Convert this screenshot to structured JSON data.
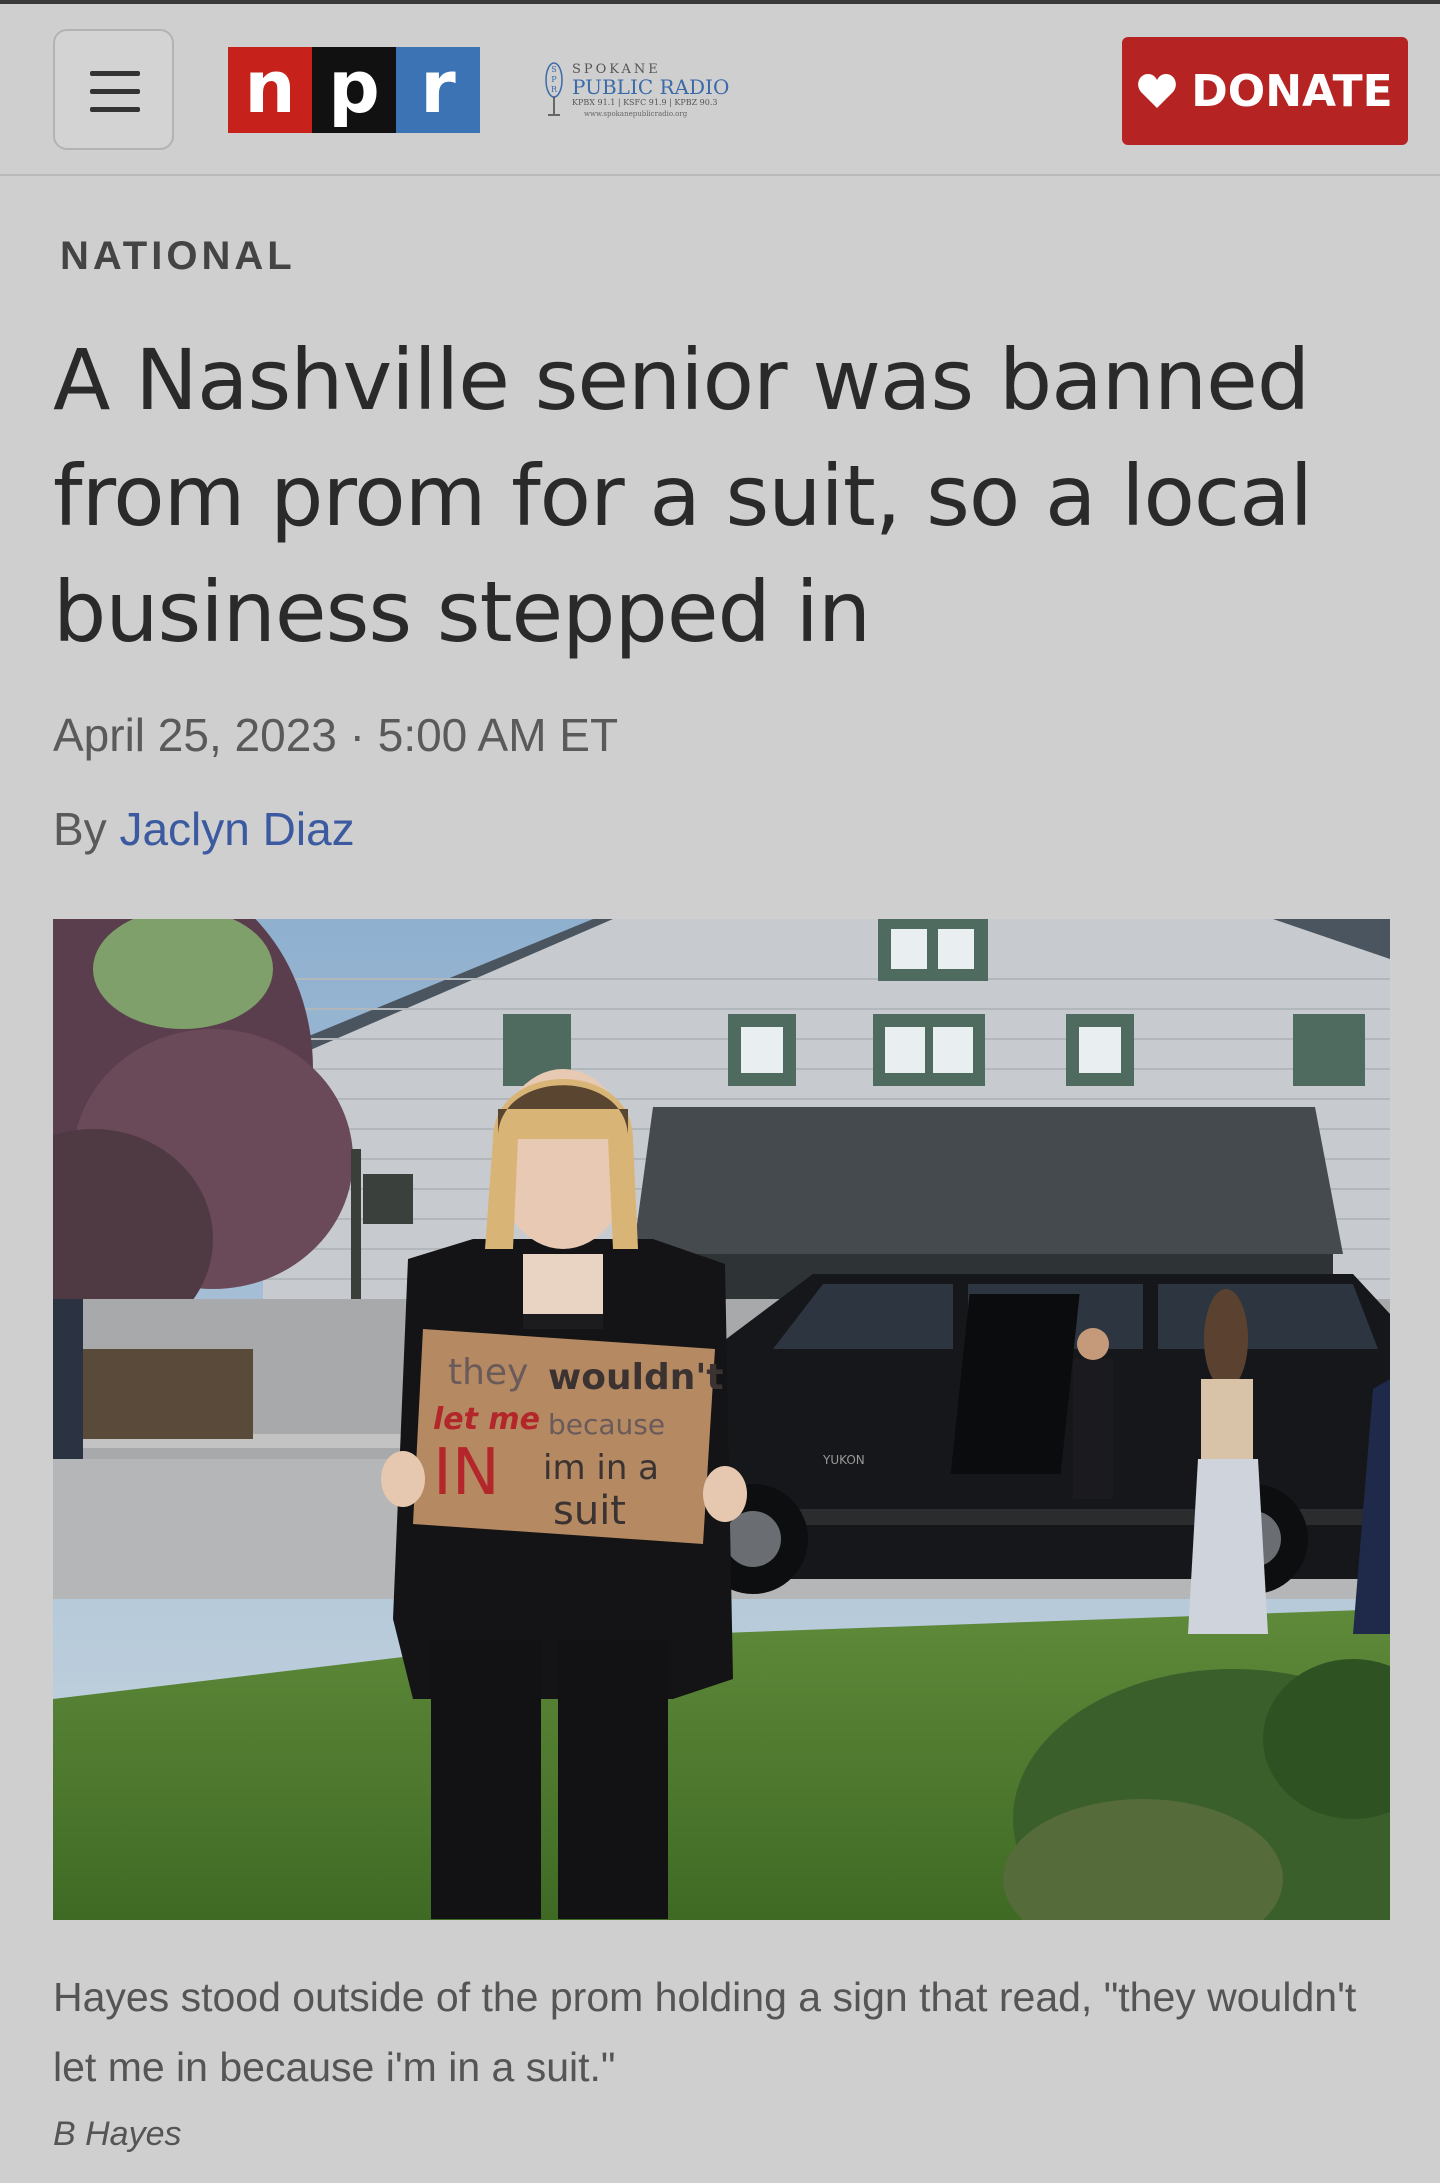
{
  "header": {
    "npr_logo": [
      "n",
      "p",
      "r"
    ],
    "station": {
      "top": "SPOKANE",
      "name": "PUBLIC RADIO",
      "frequencies": "KPBX 91.1 | KSFC 91.9 | KPBZ 90.3",
      "url": "www.spokanepublicradio.org"
    },
    "donate_label": "DONATE",
    "colors": {
      "npr_n": "#c7211b",
      "npr_p": "#111111",
      "npr_r": "#3b73b4",
      "donate": "#b52323"
    }
  },
  "article": {
    "section": "NATIONAL",
    "headline": "A Nashville senior was banned from prom for a suit, so a local business stepped in",
    "date": "April 25, 2023 · 5:00 AM ET",
    "by_prefix": "By",
    "author": "Jaclyn Diaz",
    "caption": "Hayes stood outside of the prom holding a sign that read, \"they wouldn't let me in because i'm in a suit.\"",
    "credit": "B Hayes",
    "sign": {
      "line1a": "they",
      "line1b": "wouldn't",
      "line2a": "let me",
      "line2b": "because",
      "line3a": "IN",
      "line3b": "im in a",
      "line4": "suit"
    },
    "car_badge": "YUKON"
  }
}
